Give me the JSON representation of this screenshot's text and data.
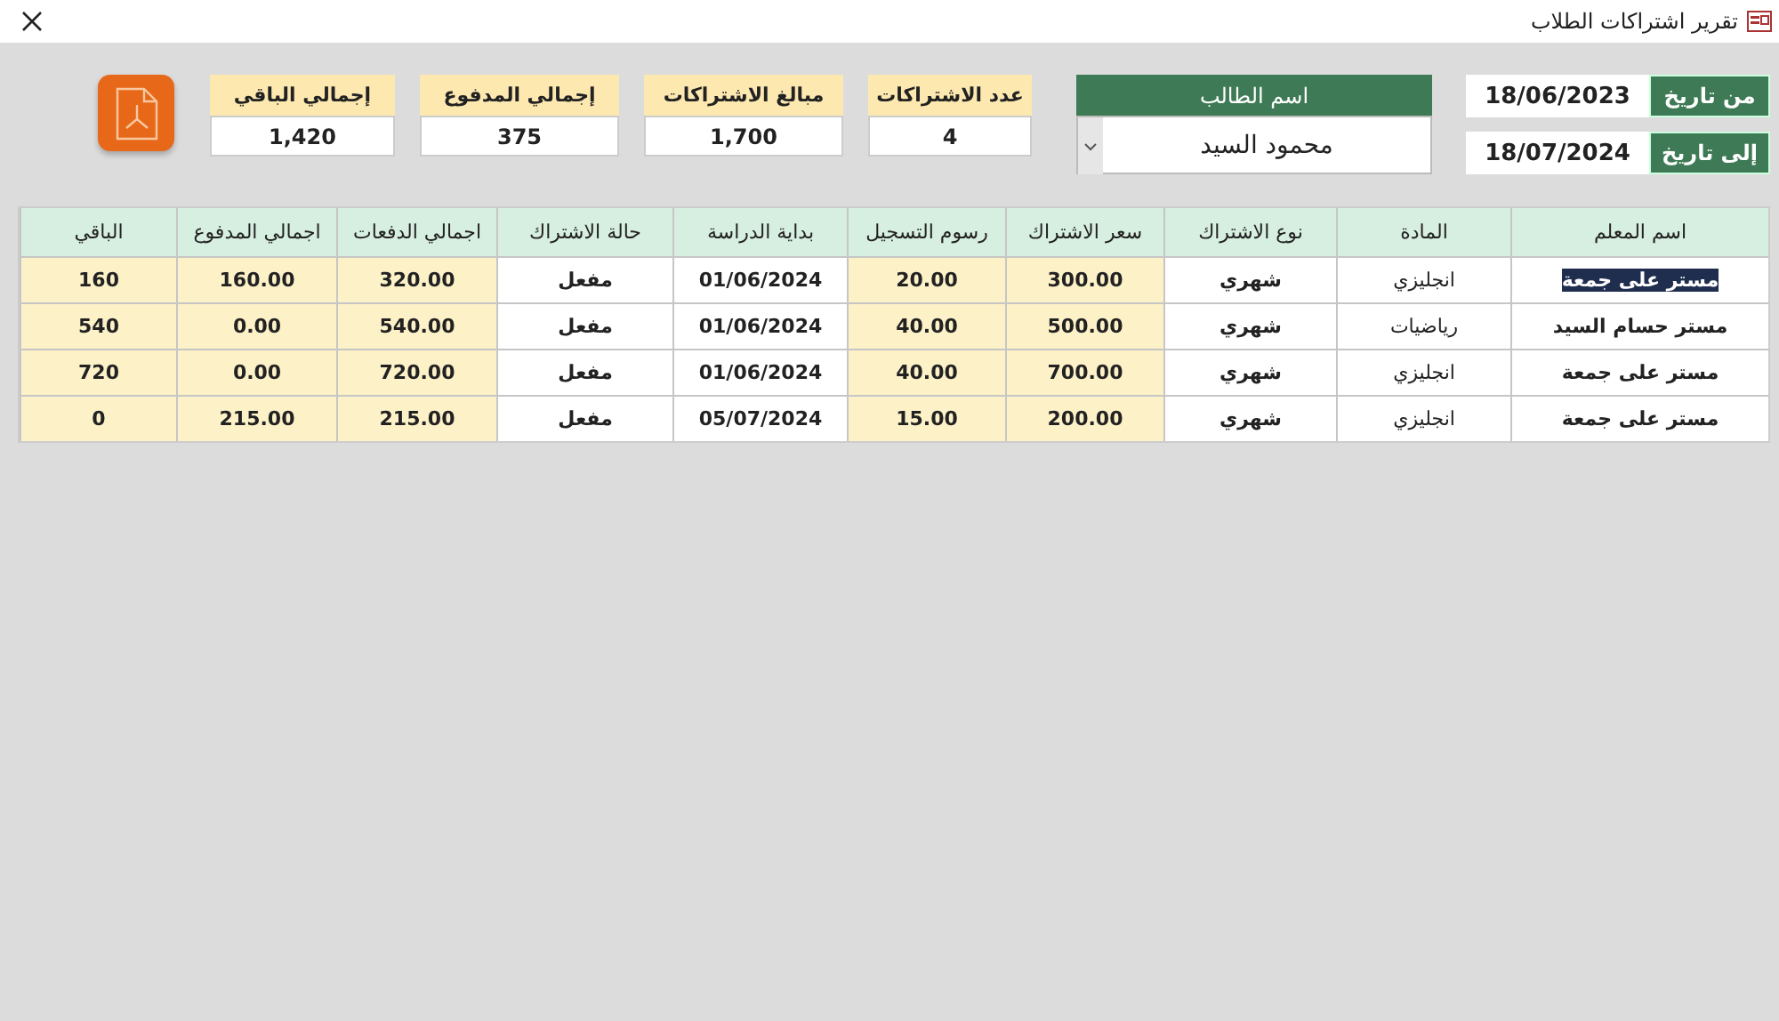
{
  "window": {
    "title": "تقرير اشتراكات الطلاب"
  },
  "dates": [
    {
      "label": "من تاريخ",
      "value": "18/06/2023"
    },
    {
      "label": "إلى تاريخ",
      "value": "18/07/2024"
    }
  ],
  "student": {
    "label": "اسم الطالب",
    "value": "محمود السيد"
  },
  "summary": [
    {
      "label": "عدد الاشتراكات",
      "value": "4"
    },
    {
      "label": "مبالغ الاشتراكات",
      "value": "1,700"
    },
    {
      "label": "إجمالي المدفوع",
      "value": "375"
    },
    {
      "label": "إجمالي الباقي",
      "value": "1,420"
    }
  ],
  "table": {
    "columns": [
      {
        "label": "اسم المعلم",
        "shaded": false
      },
      {
        "label": "المادة",
        "shaded": false
      },
      {
        "label": "نوع الاشتراك",
        "shaded": false
      },
      {
        "label": "سعر الاشتراك",
        "shaded": true
      },
      {
        "label": "رسوم التسجيل",
        "shaded": true
      },
      {
        "label": "بداية الدراسة",
        "shaded": false
      },
      {
        "label": "حالة الاشتراك",
        "shaded": false
      },
      {
        "label": "اجمالي الدفعات",
        "shaded": true
      },
      {
        "label": "اجمالي المدفوع",
        "shaded": true
      },
      {
        "label": "الباقي",
        "shaded": true
      }
    ],
    "rows": [
      {
        "selected": true,
        "cells": [
          "مستر على جمعة",
          "انجليزي",
          "شهري",
          "300.00",
          "20.00",
          "01/06/2024",
          "مفعل",
          "320.00",
          "160.00",
          "160"
        ]
      },
      {
        "selected": false,
        "cells": [
          "مستر حسام السيد",
          "رياضيات",
          "شهري",
          "500.00",
          "40.00",
          "01/06/2024",
          "مفعل",
          "540.00",
          "0.00",
          "540"
        ]
      },
      {
        "selected": false,
        "cells": [
          "مستر على جمعة",
          "انجليزي",
          "شهري",
          "700.00",
          "40.00",
          "01/06/2024",
          "مفعل",
          "720.00",
          "0.00",
          "720"
        ]
      },
      {
        "selected": false,
        "cells": [
          "مستر على جمعة",
          "انجليزي",
          "شهري",
          "200.00",
          "15.00",
          "05/07/2024",
          "مفعل",
          "215.00",
          "215.00",
          "0"
        ]
      }
    ]
  }
}
